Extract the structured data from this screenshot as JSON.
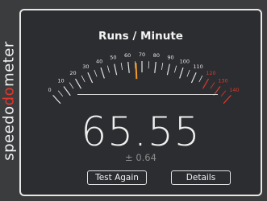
{
  "brand": {
    "prefix": "speedo",
    "middle": "do",
    "suffix": "meter",
    "accent_color": "#e0392e"
  },
  "gauge": {
    "title": "Runs / Minute",
    "ticks": [
      0,
      10,
      20,
      30,
      40,
      50,
      60,
      70,
      80,
      90,
      100,
      110,
      120,
      130,
      140
    ],
    "red_from": 120,
    "max": 140,
    "needle_value": 65.55,
    "needle_color": "#f09a2a",
    "red_color": "#e0392e"
  },
  "result": {
    "value": "65.55",
    "error": "± 0.64"
  },
  "buttons": {
    "test_again": "Test Again",
    "details": "Details"
  }
}
